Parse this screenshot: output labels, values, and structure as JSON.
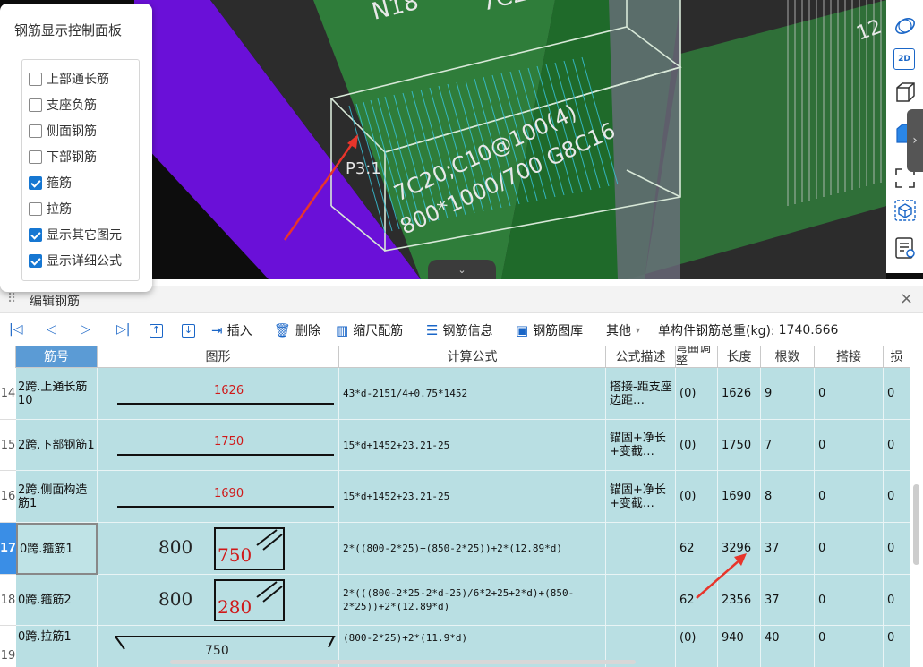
{
  "viewport": {
    "scene_texts": [
      "N18",
      "7C2",
      "P3:1",
      "7C20;C10@100(4)",
      "800*1000/700 G8C16",
      "12"
    ]
  },
  "control_panel": {
    "title": "钢筋显示控制面板",
    "items": [
      {
        "label": "上部通长筋",
        "checked": false
      },
      {
        "label": "支座负筋",
        "checked": false
      },
      {
        "label": "侧面钢筋",
        "checked": false
      },
      {
        "label": "下部钢筋",
        "checked": false
      },
      {
        "label": "箍筋",
        "checked": true
      },
      {
        "label": "拉筋",
        "checked": false
      },
      {
        "label": "显示其它图元",
        "checked": true
      },
      {
        "label": "显示详细公式",
        "checked": true
      }
    ]
  },
  "right_toolbar": {
    "icons": [
      "orbit-icon",
      "view-2d-icon",
      "cube-icon",
      "solid-cube-icon",
      "fullscreen-icon",
      "box-view-icon",
      "report-view-icon"
    ],
    "label_2d": "2D"
  },
  "editor": {
    "title": "编辑钢筋",
    "close": "×",
    "drag_handle": "⠿",
    "toolbar": {
      "insert": "插入",
      "delete": "删除",
      "scale_rebar": "缩尺配筋",
      "rebar_info": "钢筋信息",
      "rebar_library": "钢筋图库",
      "other": "其他",
      "other_caret": "▾",
      "total_weight_label": "单构件钢筋总重(kg):",
      "total_weight_value": "1740.666"
    },
    "columns": {
      "name": "筋号",
      "shape": "图形",
      "formula": "计算公式",
      "desc": "公式描述",
      "bend": "弯曲调整",
      "length": "长度",
      "count": "根数",
      "lap": "搭接",
      "loss": "损"
    },
    "rows": [
      {
        "num": "14",
        "name": "2跨.上通长筋10",
        "shape": "line",
        "shape_value": "1626",
        "formula": "43*d-2151/4+0.75*1452",
        "desc": "搭接-距支座边距…",
        "bend": "(0)",
        "length": "1626",
        "count": "9",
        "lap": "0",
        "loss": "0"
      },
      {
        "num": "15",
        "name": "2跨.下部钢筋1",
        "shape": "line",
        "shape_value": "1750",
        "formula": "15*d+1452+23.21-25",
        "desc": "锚固+净长+变截…",
        "bend": "(0)",
        "length": "1750",
        "count": "7",
        "lap": "0",
        "loss": "0"
      },
      {
        "num": "16",
        "name": "2跨.侧面构造筋1",
        "shape": "line",
        "shape_value": "1690",
        "formula": "15*d+1452+23.21-25",
        "desc": "锚固+净长+变截…",
        "bend": "(0)",
        "length": "1690",
        "count": "8",
        "lap": "0",
        "loss": "0"
      },
      {
        "num": "17",
        "name": "0跨.箍筋1",
        "shape": "stirrup",
        "shape_w": "800",
        "shape_h": "750",
        "formula": "2*((800-2*25)+(850-2*25))+2*(12.89*d)",
        "desc": "",
        "bend": "62",
        "length": "3296",
        "count": "37",
        "lap": "0",
        "loss": "0"
      },
      {
        "num": "18",
        "name": "0跨.箍筋2",
        "shape": "stirrup",
        "shape_w": "800",
        "shape_h": "280",
        "formula": "2*(((800-2*25-2*d-25)/6*2+25+2*d)+(850-2*25))+2*(12.89*d)",
        "desc": "",
        "bend": "62",
        "length": "2356",
        "count": "37",
        "lap": "0",
        "loss": "0"
      },
      {
        "num": "19",
        "name": "0跨.拉筋1",
        "shape": "tie",
        "shape_value": "750",
        "formula": "(800-2*25)+2*(11.9*d)",
        "desc": "",
        "bend": "(0)",
        "length": "940",
        "count": "40",
        "lap": "0",
        "loss": "0"
      }
    ],
    "active_row": "17"
  },
  "colors": {
    "accent": "#1a66c7",
    "row_bg": "#b9dfe3",
    "header_selected": "#5b9bd5",
    "annotation_arrow": "#e8352b"
  }
}
